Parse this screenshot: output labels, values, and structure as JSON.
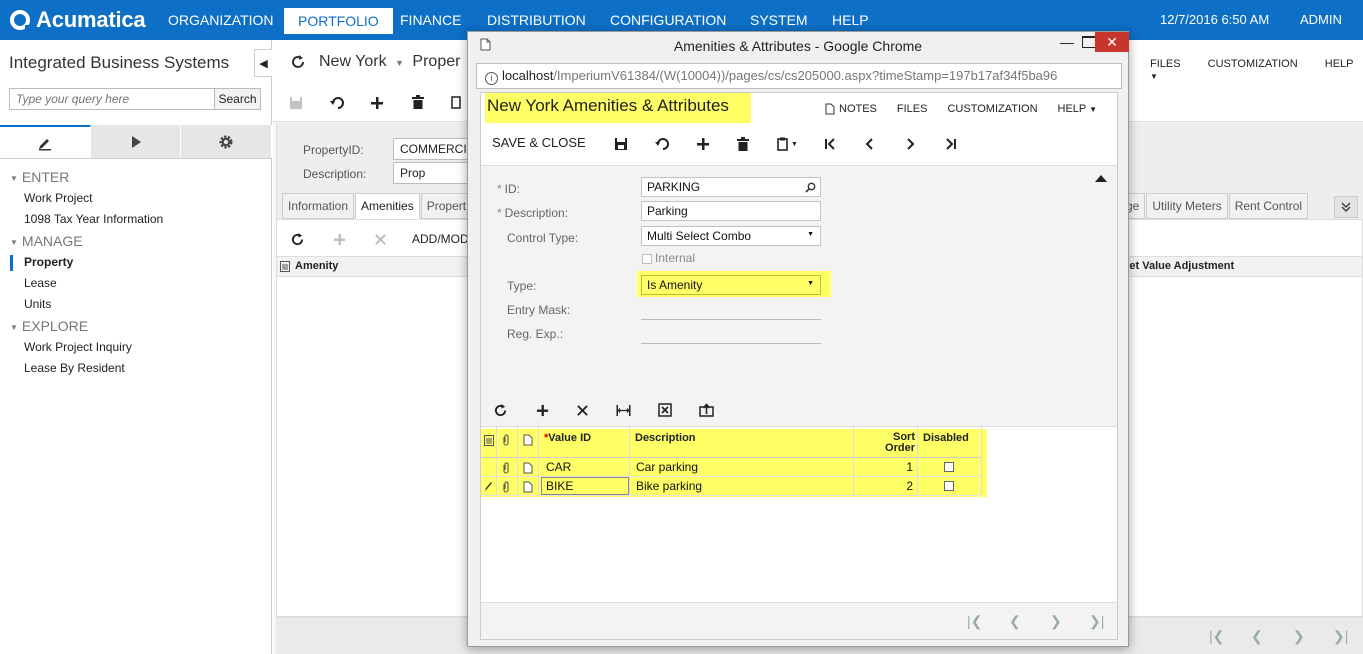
{
  "topbar": {
    "logo": "Acumatica",
    "menu": [
      "ORGANIZATION",
      "PORTFOLIO",
      "FINANCE",
      "DISTRIBUTION",
      "CONFIGURATION",
      "SYSTEM",
      "HELP"
    ],
    "datetime": "12/7/2016  6:50 AM",
    "user": "ADMIN"
  },
  "sidebar": {
    "company": "Integrated Business Systems",
    "search_placeholder": "Type your query here",
    "search_button": "Search",
    "sections": [
      {
        "title": "ENTER",
        "items": [
          "Work Project",
          "1098 Tax Year Information"
        ]
      },
      {
        "title": "MANAGE",
        "items": [
          "Property",
          "Lease",
          "Units"
        ]
      },
      {
        "title": "EXPLORE",
        "items": [
          "Work Project Inquiry",
          "Lease By Resident"
        ]
      }
    ]
  },
  "main": {
    "title": "New York",
    "title_cut": "Proper",
    "right_links": {
      "files": "FILES",
      "customization": "CUSTOMIZATION",
      "help": "HELP"
    },
    "property_id_label": "PropertyID:",
    "property_id_value": "COMMERCI",
    "description_label": "Description:",
    "description_value": "Prop",
    "tabs": [
      "Information",
      "Amenities",
      "Propert"
    ],
    "right_tabs": [
      "ge",
      "Utility Meters",
      "Rent Control"
    ],
    "grid_add_label": "ADD/MOD",
    "grid_col_amenity": "Amenity",
    "grid_col_right": "rket Value Adjustment"
  },
  "popup": {
    "window_title": "Amenities & Attributes - Google Chrome",
    "url_host": "localhost",
    "url_path": "/ImperiumV61384/(W(10004))/pages/cs/cs205000.aspx?timeStamp=197b17af34f5ba96",
    "screen_title": "New York  Amenities & Attributes",
    "links": {
      "notes": "NOTES",
      "files": "FILES",
      "customization": "CUSTOMIZATION",
      "help": "HELP"
    },
    "save_close": "SAVE & CLOSE",
    "form": {
      "id_label": "ID:",
      "id_value": "PARKING",
      "desc_label": "Description:",
      "desc_value": "Parking",
      "control_type_label": "Control Type:",
      "control_type_value": "Multi Select Combo",
      "internal_label": "Internal",
      "type_label": "Type:",
      "type_value": "Is Amenity",
      "entry_mask_label": "Entry Mask:",
      "reg_exp_label": "Reg. Exp.:"
    },
    "grid": {
      "col_value_id": "Value ID",
      "col_description": "Description",
      "col_sort_order_1": "Sort",
      "col_sort_order_2": "Order",
      "col_disabled": "Disabled",
      "rows": [
        {
          "value_id": "CAR",
          "description": "Car parking",
          "sort_order": "1"
        },
        {
          "value_id": "BIKE",
          "description": "Bike parking",
          "sort_order": "2"
        }
      ]
    }
  },
  "colors": {
    "brand": "#0d6fc5",
    "highlight": "#ffff66",
    "close": "#c8352a"
  }
}
